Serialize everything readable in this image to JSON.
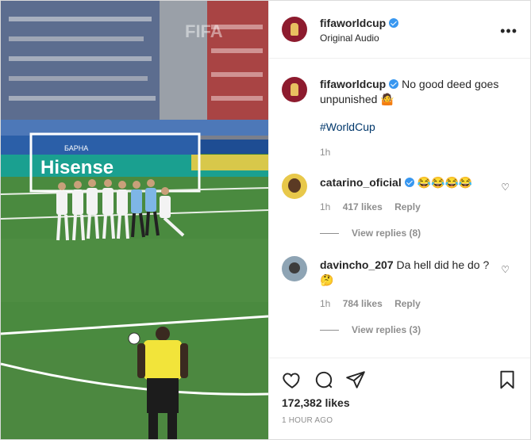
{
  "post": {
    "username": "fifaworldcup",
    "audio": "Original Audio",
    "more_icon": "more-icon",
    "caption": {
      "text": "No good deed goes unpunished 🤷",
      "hashtag": "#WorldCup",
      "time": "1h"
    },
    "comments": [
      {
        "username": "catarino_oficial",
        "verified": true,
        "text": "😂😂😂😂",
        "time": "1h",
        "likes": "417 likes",
        "reply": "Reply",
        "view_replies": "View replies (8)"
      },
      {
        "username": "davincho_207",
        "verified": false,
        "text": "Da hell did he do ? 🤔",
        "time": "1h",
        "likes": "784 likes",
        "reply": "Reply",
        "view_replies": "View replies (3)"
      }
    ],
    "likes_count": "172,382 likes",
    "timestamp": "1 HOUR AGO"
  },
  "media": {
    "watermark": "FIFA",
    "ad_board_text": "Hisense",
    "ad_board_small": "БАРНА"
  },
  "colors": {
    "verified": "#3897f0",
    "hashtag": "#00376b",
    "avatar": "#8d1b2e",
    "muted": "#8e8e8e"
  }
}
